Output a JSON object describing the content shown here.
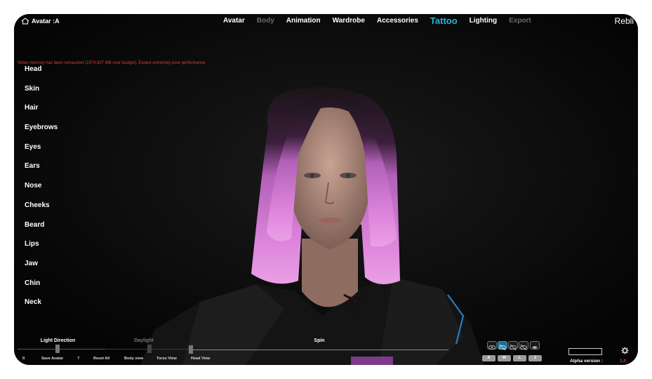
{
  "header": {
    "avatar_label": "Avatar :A",
    "nav": [
      {
        "label": "Avatar",
        "state": "normal"
      },
      {
        "label": "Body",
        "state": "dim"
      },
      {
        "label": "Animation",
        "state": "normal"
      },
      {
        "label": "Wardrobe",
        "state": "normal"
      },
      {
        "label": "Accessories",
        "state": "normal"
      },
      {
        "label": "Tattoo",
        "state": "active"
      },
      {
        "label": "Lighting",
        "state": "normal"
      },
      {
        "label": "Export",
        "state": "dim"
      }
    ],
    "brand": "Rebli"
  },
  "warning": "Video memory has been exhausted (1974.837 MB over budget). Expect extremely poor performance.",
  "sidebar": {
    "items": [
      "Head",
      "Skin",
      "Hair",
      "Eyebrows",
      "Eyes",
      "Ears",
      "Nose",
      "Cheeks",
      "Beard",
      "Lips",
      "Jaw",
      "Chin",
      "Neck"
    ]
  },
  "bottom": {
    "light_direction_label": "Light Direction",
    "daylight_label": "Daylight",
    "spin_label": "Spin",
    "buttons": [
      "Save Avatar",
      "?",
      "Reset All",
      "Body view",
      "Torso View",
      "Head View"
    ],
    "cropped_left_label": "ll"
  },
  "view_toggles": [
    "eye-icon",
    "eye-slash-icon-selected",
    "eye-slash-icon",
    "eye-slash-icon",
    "lips-icon"
  ],
  "layer_buttons": [
    "A",
    "W",
    "L",
    "2"
  ],
  "alpha": {
    "label": "Alpha version :",
    "value": "1.0"
  },
  "colors": {
    "accent": "#2ab7d8",
    "warning": "#d83a3a",
    "hair_pink": "#d977d6"
  }
}
